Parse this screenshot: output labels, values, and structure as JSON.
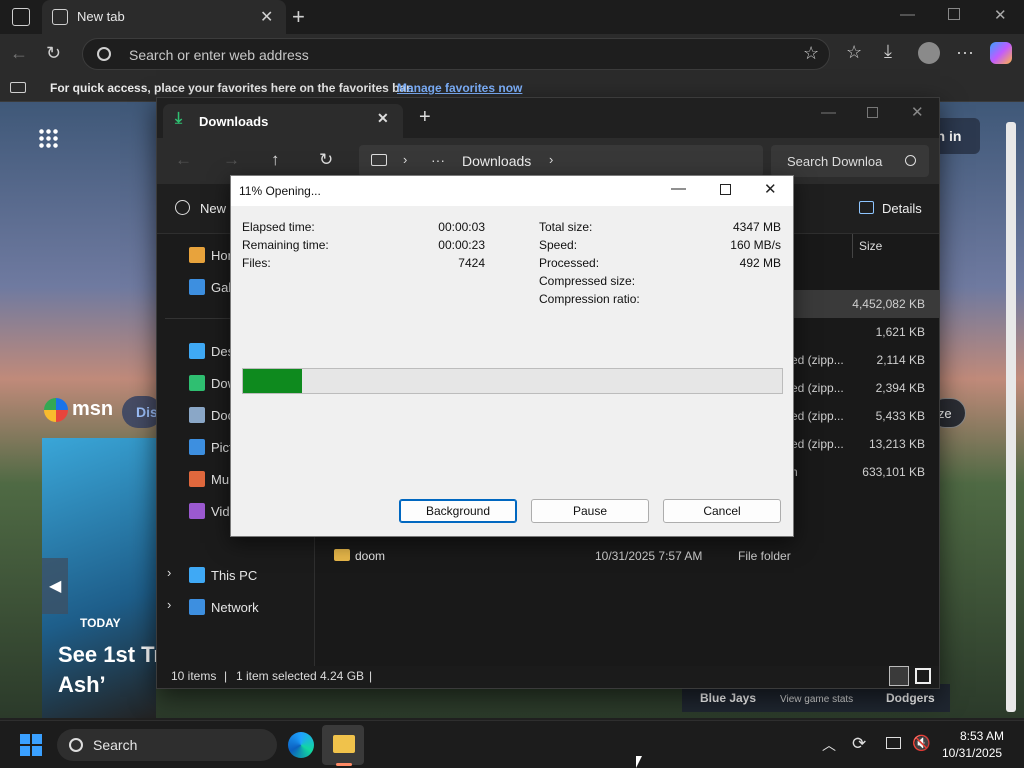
{
  "browser": {
    "tab_title": "New tab",
    "address_placeholder": "Search or enter web address",
    "favbar_text": "For quick access, place your favorites here on the favorites bar.",
    "favbar_link": "Manage favorites now"
  },
  "msn": {
    "logo": "msn",
    "discover": "Dis",
    "sign_in": "gn in",
    "resize": "ize",
    "today": "TODAY",
    "headline_1": "See 1st Tr",
    "headline_2": "Ash’",
    "sports_left": "Blue Jays",
    "sports_mid": "View game stats",
    "sports_right": "Dodgers"
  },
  "explorer": {
    "tab_title": "Downloads",
    "breadcrumb_ellipsis": "···",
    "breadcrumb_current": "Downloads",
    "search_placeholder": "Search Downloa",
    "new_label": "New",
    "details_label": "Details",
    "size_header": "Size",
    "sidebar": [
      {
        "label": "Hor",
        "icon": "home-icon",
        "color": "#e8a33c"
      },
      {
        "label": "Gall",
        "icon": "gallery-icon",
        "color": "#3d8fe0"
      },
      {
        "label": "Des",
        "icon": "desktop-icon",
        "color": "#3fa9f5"
      },
      {
        "label": "Dow",
        "icon": "download-icon",
        "color": "#2fbf71"
      },
      {
        "label": "Doc",
        "icon": "document-icon",
        "color": "#8aa7c7"
      },
      {
        "label": "Pict",
        "icon": "pictures-icon",
        "color": "#3d8fe0"
      },
      {
        "label": "Mu",
        "icon": "music-icon",
        "color": "#e0683d"
      },
      {
        "label": "Vide",
        "icon": "videos-icon",
        "color": "#9b59d0"
      }
    ],
    "tree": [
      {
        "label": "This PC"
      },
      {
        "label": "Network"
      }
    ],
    "rows": [
      {
        "type": "",
        "size": "4,452,082 KB"
      },
      {
        "type": "",
        "size": "1,621 KB"
      },
      {
        "type": "ed (zipp...",
        "size": "2,114 KB"
      },
      {
        "type": "ed (zipp...",
        "size": "2,394 KB"
      },
      {
        "type": "ed (zipp...",
        "size": "5,433 KB"
      },
      {
        "type": "ed (zipp...",
        "size": "13,213 KB"
      },
      {
        "type": "n",
        "size": "633,101 KB"
      }
    ],
    "folder_row": {
      "name": "doom",
      "date": "10/31/2025 7:57 AM",
      "type": "File folder"
    },
    "status": {
      "items": "10 items",
      "selected": "1 item selected",
      "size": "4.24 GB"
    }
  },
  "dialog": {
    "title": "11% Opening...",
    "progress_percent": 11,
    "left": [
      {
        "label": "Elapsed time:",
        "value": "00:00:03"
      },
      {
        "label": "Remaining time:",
        "value": "00:00:23"
      },
      {
        "label": "Files:",
        "value": "7424"
      }
    ],
    "right": [
      {
        "label": "Total size:",
        "value": "4347 MB"
      },
      {
        "label": "Speed:",
        "value": "160 MB/s"
      },
      {
        "label": "Processed:",
        "value": "492 MB"
      },
      {
        "label": "Compressed size:",
        "value": ""
      },
      {
        "label": "Compression ratio:",
        "value": ""
      }
    ],
    "buttons": {
      "background": "Background",
      "pause": "Pause",
      "cancel": "Cancel"
    }
  },
  "taskbar": {
    "search_label": "Search",
    "time": "8:53 AM",
    "date": "10/31/2025"
  }
}
